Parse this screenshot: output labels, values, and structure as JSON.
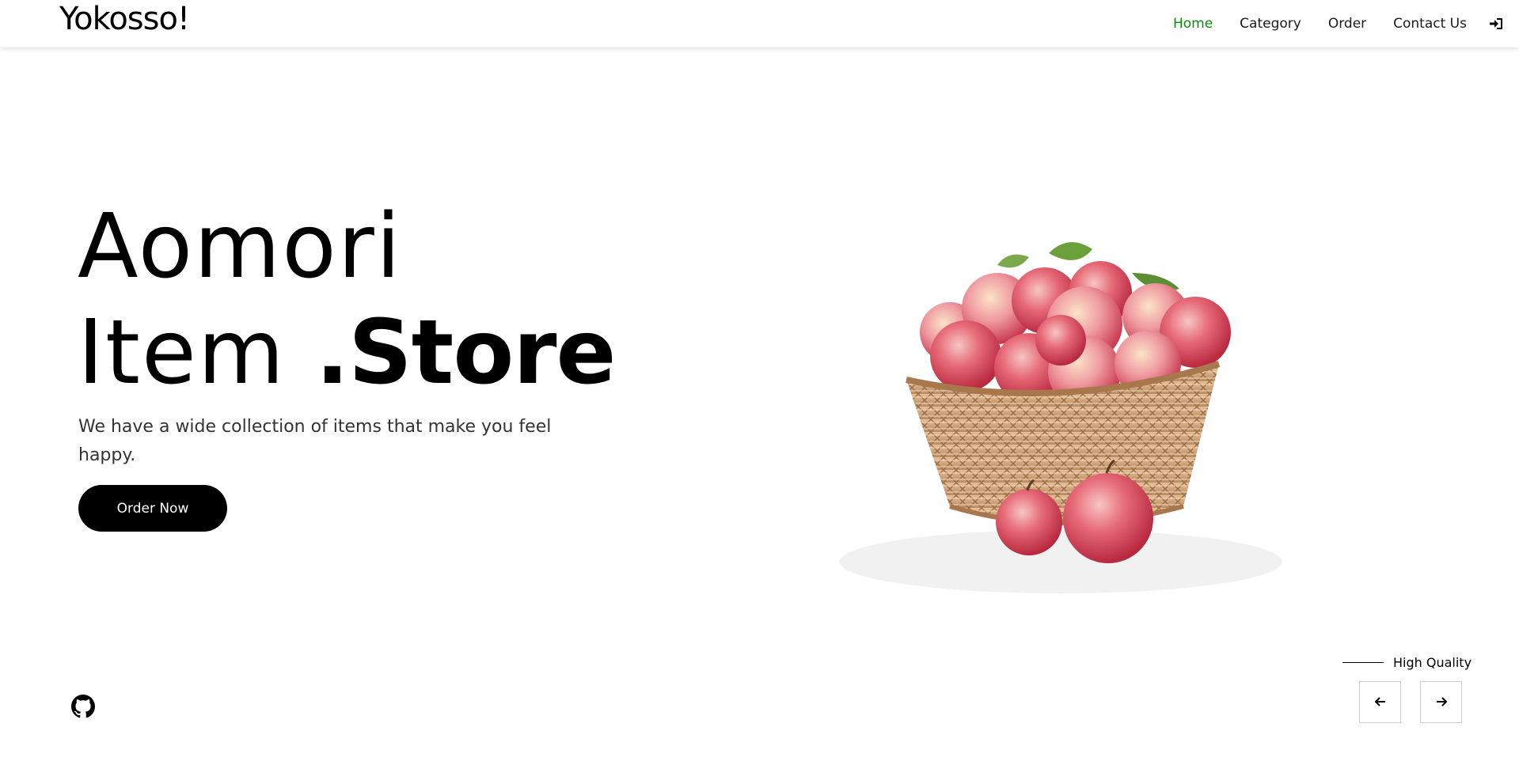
{
  "brand": {
    "logo": "Yokosso!"
  },
  "nav": {
    "items": [
      {
        "label": "Home",
        "active": true
      },
      {
        "label": "Category",
        "active": false
      },
      {
        "label": "Order",
        "active": false
      },
      {
        "label": "Contact Us",
        "active": false
      }
    ],
    "login_icon": "sign-in-icon",
    "active_color": "#0b8a0b"
  },
  "hero": {
    "title_line1": "Aomori",
    "title_line2_a": "Item ",
    "title_line2_b": ".Store",
    "description": "We have a wide collection of items that make you feel happy.",
    "order_button": "Order Now",
    "image_icon": "apple-basket-image"
  },
  "footer": {
    "github_icon": "github-icon",
    "tagline": "High Quality",
    "prev_icon": "arrow-left-icon",
    "next_icon": "arrow-right-icon"
  }
}
